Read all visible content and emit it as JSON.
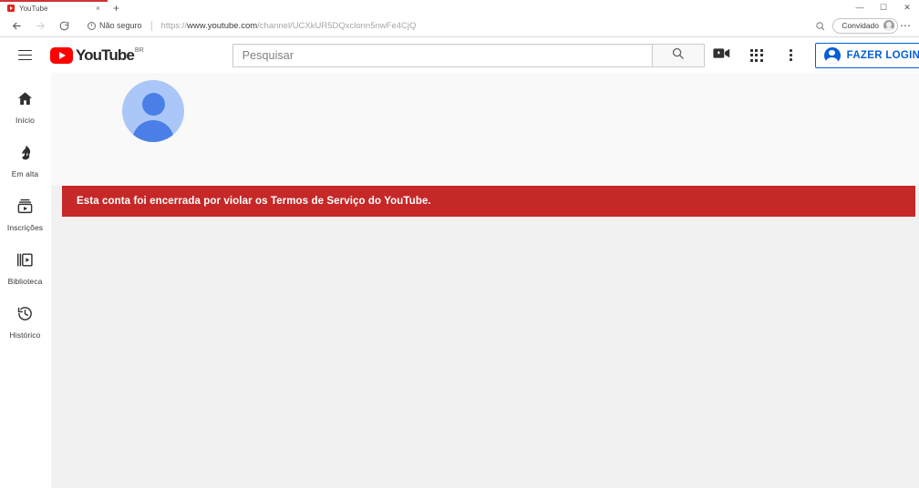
{
  "browser": {
    "tab": {
      "title": "YouTube",
      "favicon_name": "youtube-favicon",
      "close_label": "×",
      "new_tab_label": "+"
    },
    "window_controls": {
      "minimize": "—",
      "maximize": "☐",
      "close": "✕"
    },
    "nav": {
      "back_label": "←",
      "forward_label": "→",
      "reload_label": "↻"
    },
    "omnibox": {
      "security_text": "Não seguro",
      "info_glyph": "i",
      "url_scheme": "https://",
      "url_host": "www.youtube.com",
      "url_path": "/channel/UCXkUR5DQxclonn5nwFe4CjQ",
      "full_url": "https://www.youtube.com/channel/UCXkUR5DQxclonn5nwFe4CjQ",
      "zoom_icon_label": "⌕"
    },
    "profile": {
      "label": "Convidado"
    },
    "settings_label": "⋯"
  },
  "youtube": {
    "header": {
      "menu_label": "Guide",
      "logo_text": "YouTube",
      "logo_country": "BR",
      "search": {
        "placeholder": "Pesquisar",
        "search_button_label": "search-icon"
      },
      "create_icon": "video-camera-icon",
      "apps_icon": "apps-grid-icon",
      "more_icon": "kebab-menu-icon",
      "signin_label": "FAZER LOGIN"
    },
    "sidebar": {
      "items": [
        {
          "label": "Início",
          "icon": "home-icon"
        },
        {
          "label": "Em alta",
          "icon": "trending-flame-icon"
        },
        {
          "label": "Inscrições",
          "icon": "subscriptions-icon"
        },
        {
          "label": "Biblioteca",
          "icon": "library-icon"
        },
        {
          "label": "Histórico",
          "icon": "history-clock-icon"
        }
      ]
    },
    "channel": {
      "avatar_alt": "default-channel-avatar",
      "notice": "Esta conta foi encerrada por violar os Termos de Serviço do YouTube."
    },
    "colors": {
      "notice_bg": "#c62828",
      "brand_red": "#ff0000",
      "signin_blue": "#065fd4",
      "page_bg": "#f1f1f1",
      "avatar_bg": "#aac7f8",
      "avatar_fg": "#4a7fe8"
    }
  }
}
